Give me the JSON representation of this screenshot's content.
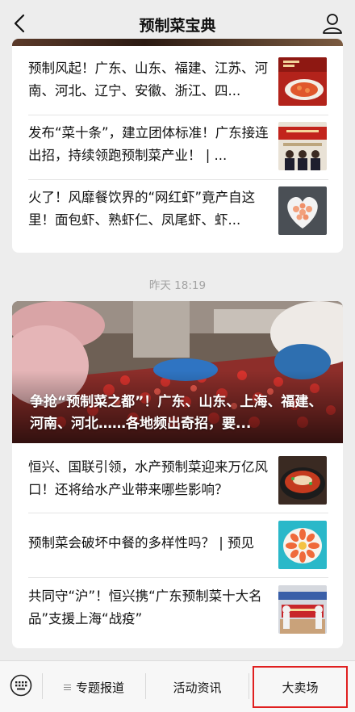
{
  "navbar": {
    "title": "预制菜宝典"
  },
  "group1": {
    "items": [
      {
        "text": "预制风起！广东、山东、福建、江苏、河南、河北、辽宁、安徽、浙江、四..."
      },
      {
        "text": "发布“菜十条”，建立团体标准！广东接连出招，持续领跑预制菜产业！ | ..."
      },
      {
        "text": "火了！风靡餐饮界的“网红虾”竟产自这里！面包虾、熟虾仁、凤尾虾、虾..."
      }
    ]
  },
  "timestamp": "昨天 18:19",
  "group2": {
    "headline": "争抢“预制菜之都”！广东、山东、上海、福建、河南、河北……各地频出奇招，要...",
    "items": [
      {
        "text": "恒兴、国联引领，水产预制菜迎来万亿风口！还将给水产业带来哪些影响？"
      },
      {
        "text": "预制菜会破坏中餐的多样性吗？ | 预见"
      },
      {
        "text": "共同守“沪”！恒兴携“广东预制菜十大名品”支援上海“战疫”"
      }
    ]
  },
  "bottom_menu": {
    "items": [
      {
        "label": "专题报道"
      },
      {
        "label": "活动资讯"
      },
      {
        "label": "大卖场"
      }
    ]
  },
  "colors": {
    "highlight_border": "#e02020",
    "background": "#ededed"
  },
  "icons": {
    "back": "chevron-left-icon",
    "profile": "person-icon",
    "keyboard": "keyboard-icon",
    "submenu": "submenu-lines-icon"
  }
}
